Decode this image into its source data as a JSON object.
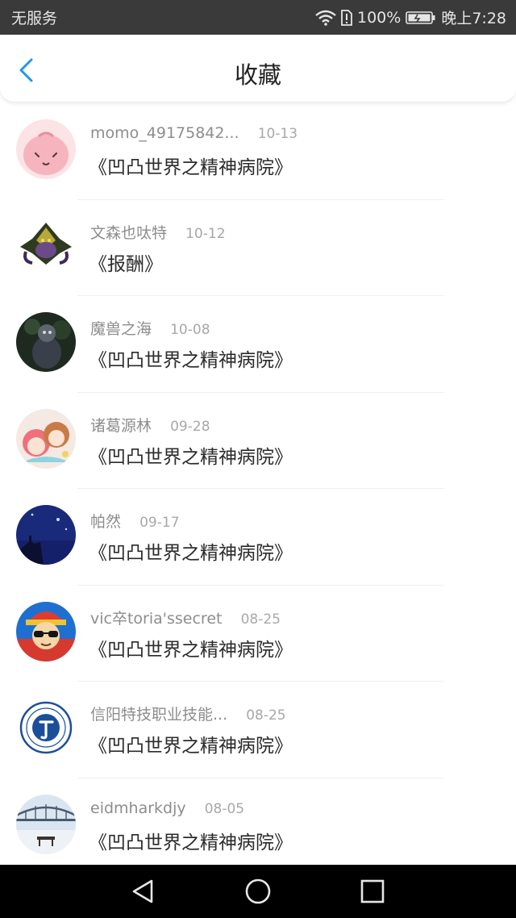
{
  "status_bar": {
    "carrier": "无服务",
    "battery_percent": "100%",
    "time": "晚上7:28"
  },
  "header": {
    "title": "收藏",
    "accent_color": "#2196f3"
  },
  "favorites": [
    {
      "user": "momo_49175842...",
      "date": "10-13",
      "title": "《凹凸世界之精神病院》"
    },
    {
      "user": "文森也呔特",
      "date": "10-12",
      "title": "《报酬》"
    },
    {
      "user": "魔兽之海",
      "date": "10-08",
      "title": "《凹凸世界之精神病院》"
    },
    {
      "user": "诸葛源林",
      "date": "09-28",
      "title": "《凹凸世界之精神病院》"
    },
    {
      "user": "帕然",
      "date": "09-17",
      "title": "《凹凸世界之精神病院》"
    },
    {
      "user": "vic卒toria'ssecret",
      "date": "08-25",
      "title": "《凹凸世界之精神病院》"
    },
    {
      "user": "信阳特技职业技能...",
      "date": "08-25",
      "title": "《凹凸世界之精神病院》"
    },
    {
      "user": "eidmharkdjy",
      "date": "08-05",
      "title": "《凹凸世界之精神病院》"
    }
  ],
  "icons": {
    "back": "chevron-left-icon",
    "wifi": "wifi-icon",
    "alert": "sim-alert-icon",
    "battery": "battery-icon",
    "nav_back": "triangle-back-icon",
    "nav_home": "circle-home-icon",
    "nav_recent": "square-recent-icon"
  }
}
